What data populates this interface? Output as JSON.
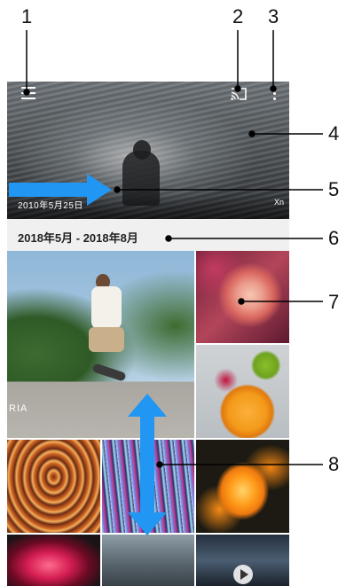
{
  "callouts": [
    "1",
    "2",
    "3",
    "4",
    "5",
    "6",
    "7",
    "8"
  ],
  "hero": {
    "date": "2010年5月25日",
    "badge": "Xn"
  },
  "date_range_header": "2018年5月 - 2018年8月",
  "skater_photo_text": "RIA",
  "icons": {
    "menu": "menu-icon",
    "cast": "cast-icon",
    "more": "more-vert-icon",
    "play": "play-icon"
  },
  "colors": {
    "arrow": "#2196F3",
    "callout_line": "#000000",
    "header_bg": "#f0f0f0"
  }
}
